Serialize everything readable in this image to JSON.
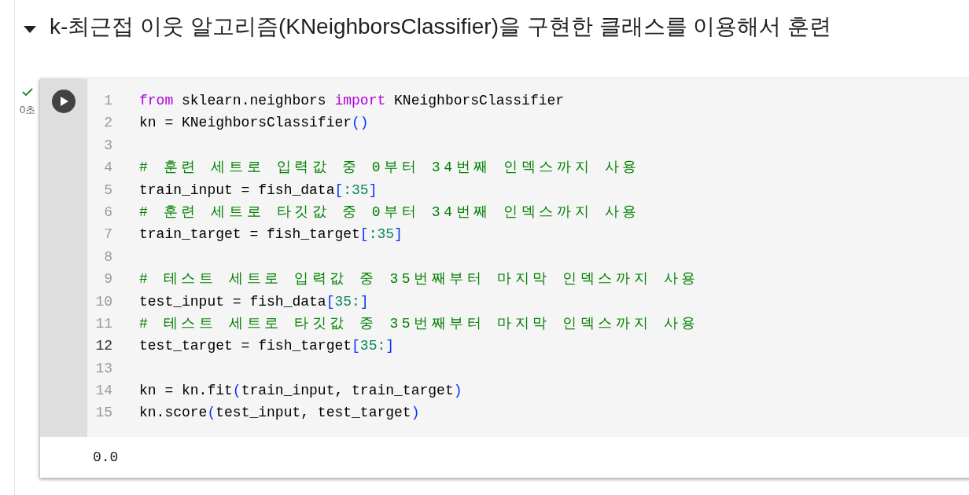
{
  "heading": {
    "text": "k-최근접 이웃 알고리즘(KNeighborsClassifier)을 구현한 클래스를 이용해서 훈련",
    "expanded": true
  },
  "cell": {
    "status": {
      "kind": "success",
      "duration": "0초"
    },
    "lines": [
      {
        "number": "1",
        "current": false,
        "tokens": [
          {
            "kind": "keyword",
            "text": "from"
          },
          {
            "kind": "plain",
            "text": " sklearn.neighbors "
          },
          {
            "kind": "keyword",
            "text": "import"
          },
          {
            "kind": "plain",
            "text": " KNeighborsClassifier"
          }
        ]
      },
      {
        "number": "2",
        "current": false,
        "tokens": [
          {
            "kind": "plain",
            "text": "kn = KNeighborsClassifier"
          },
          {
            "kind": "bracket",
            "text": "()"
          }
        ]
      },
      {
        "number": "3",
        "current": false
      },
      {
        "number": "4",
        "current": false,
        "tokens": [
          {
            "kind": "comment",
            "text": "# 훈련 세트로 입력값 중 0부터 34번째 인덱스까지 사용"
          }
        ]
      },
      {
        "number": "5",
        "current": false,
        "tokens": [
          {
            "kind": "plain",
            "text": "train_input = fish_data"
          },
          {
            "kind": "bracket",
            "text": "["
          },
          {
            "kind": "number",
            "text": ":35"
          },
          {
            "kind": "bracket",
            "text": "]"
          }
        ]
      },
      {
        "number": "6",
        "current": false,
        "tokens": [
          {
            "kind": "comment",
            "text": "# 훈련 세트로 타깃값 중 0부터 34번째 인덱스까지 사용"
          }
        ]
      },
      {
        "number": "7",
        "current": false,
        "tokens": [
          {
            "kind": "plain",
            "text": "train_target = fish_target"
          },
          {
            "kind": "bracket",
            "text": "["
          },
          {
            "kind": "number",
            "text": ":35"
          },
          {
            "kind": "bracket",
            "text": "]"
          }
        ]
      },
      {
        "number": "8",
        "current": false
      },
      {
        "number": "9",
        "current": false,
        "tokens": [
          {
            "kind": "comment",
            "text": "# 테스트 세트로 입력값 중 35번째부터 마지막 인덱스까지 사용"
          }
        ]
      },
      {
        "number": "10",
        "current": false,
        "tokens": [
          {
            "kind": "plain",
            "text": "test_input = fish_data"
          },
          {
            "kind": "bracket",
            "text": "["
          },
          {
            "kind": "number",
            "text": "35:"
          },
          {
            "kind": "bracket",
            "text": "]"
          }
        ]
      },
      {
        "number": "11",
        "current": false,
        "tokens": [
          {
            "kind": "comment",
            "text": "# 테스트 세트로 타깃값 중 35번째부터 마지막 인덱스까지 사용"
          }
        ]
      },
      {
        "number": "12",
        "current": true,
        "tokens": [
          {
            "kind": "plain",
            "text": "test_target = fish_target"
          },
          {
            "kind": "bracket",
            "text": "["
          },
          {
            "kind": "number",
            "text": "35:"
          },
          {
            "kind": "bracket",
            "text": "]"
          }
        ]
      },
      {
        "number": "13",
        "current": false
      },
      {
        "number": "14",
        "current": false,
        "tokens": [
          {
            "kind": "plain",
            "text": "kn = kn.fit"
          },
          {
            "kind": "bracket",
            "text": "("
          },
          {
            "kind": "plain",
            "text": "train_input, train_target"
          },
          {
            "kind": "bracket",
            "text": ")"
          }
        ]
      },
      {
        "number": "15",
        "current": false,
        "tokens": [
          {
            "kind": "plain",
            "text": "kn.score"
          },
          {
            "kind": "bracket",
            "text": "("
          },
          {
            "kind": "plain",
            "text": "test_input, test_target"
          },
          {
            "kind": "bracket",
            "text": ")"
          }
        ]
      }
    ],
    "output": "0.0"
  }
}
